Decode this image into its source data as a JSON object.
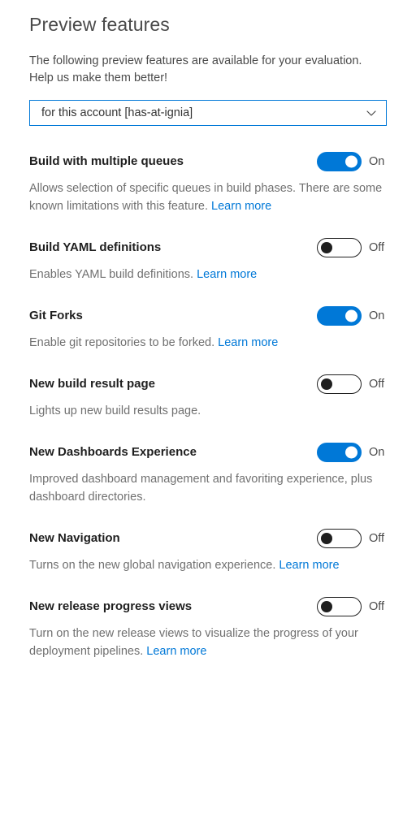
{
  "header": {
    "title": "Preview features",
    "intro": "The following preview features are available for your evaluation. Help us make them better!"
  },
  "scope": {
    "selected": "for this account [has-at-ignia]",
    "icon": "chevron-down-icon"
  },
  "labels": {
    "on": "On",
    "off": "Off",
    "learn_more": "Learn more"
  },
  "colors": {
    "accent": "#0078D7",
    "link": "#0078D7",
    "title_text": "#4A4A4A",
    "feature_name_text": "#1F1F1F",
    "description_text": "#707070",
    "toggle_off_track": "#FFFFFF",
    "toggle_off_knob": "#1F1F1F"
  },
  "features": [
    {
      "name": "Build with multiple queues",
      "state": "On",
      "enabled": true,
      "description": "Allows selection of specific queues in build phases. There are some known limitations with this feature.",
      "learn_more": "Learn more",
      "has_learn_more": true
    },
    {
      "name": "Build YAML definitions",
      "state": "Off",
      "enabled": false,
      "description": "Enables YAML build definitions.",
      "learn_more": "Learn more",
      "has_learn_more": true
    },
    {
      "name": "Git Forks",
      "state": "On",
      "enabled": true,
      "description": "Enable git repositories to be forked.",
      "learn_more": "Learn more",
      "has_learn_more": true
    },
    {
      "name": "New build result page",
      "state": "Off",
      "enabled": false,
      "description": "Lights up new build results page.",
      "learn_more": "",
      "has_learn_more": false
    },
    {
      "name": "New Dashboards Experience",
      "state": "On",
      "enabled": true,
      "description": "Improved dashboard management and favoriting experience, plus dashboard directories.",
      "learn_more": "",
      "has_learn_more": false
    },
    {
      "name": "New Navigation",
      "state": "Off",
      "enabled": false,
      "description": "Turns on the new global navigation experience.",
      "learn_more": "Learn more",
      "has_learn_more": true
    },
    {
      "name": "New release progress views",
      "state": "Off",
      "enabled": false,
      "description": "Turn on the new release views to visualize the progress of your deployment pipelines.",
      "learn_more": "Learn more",
      "has_learn_more": true
    }
  ]
}
